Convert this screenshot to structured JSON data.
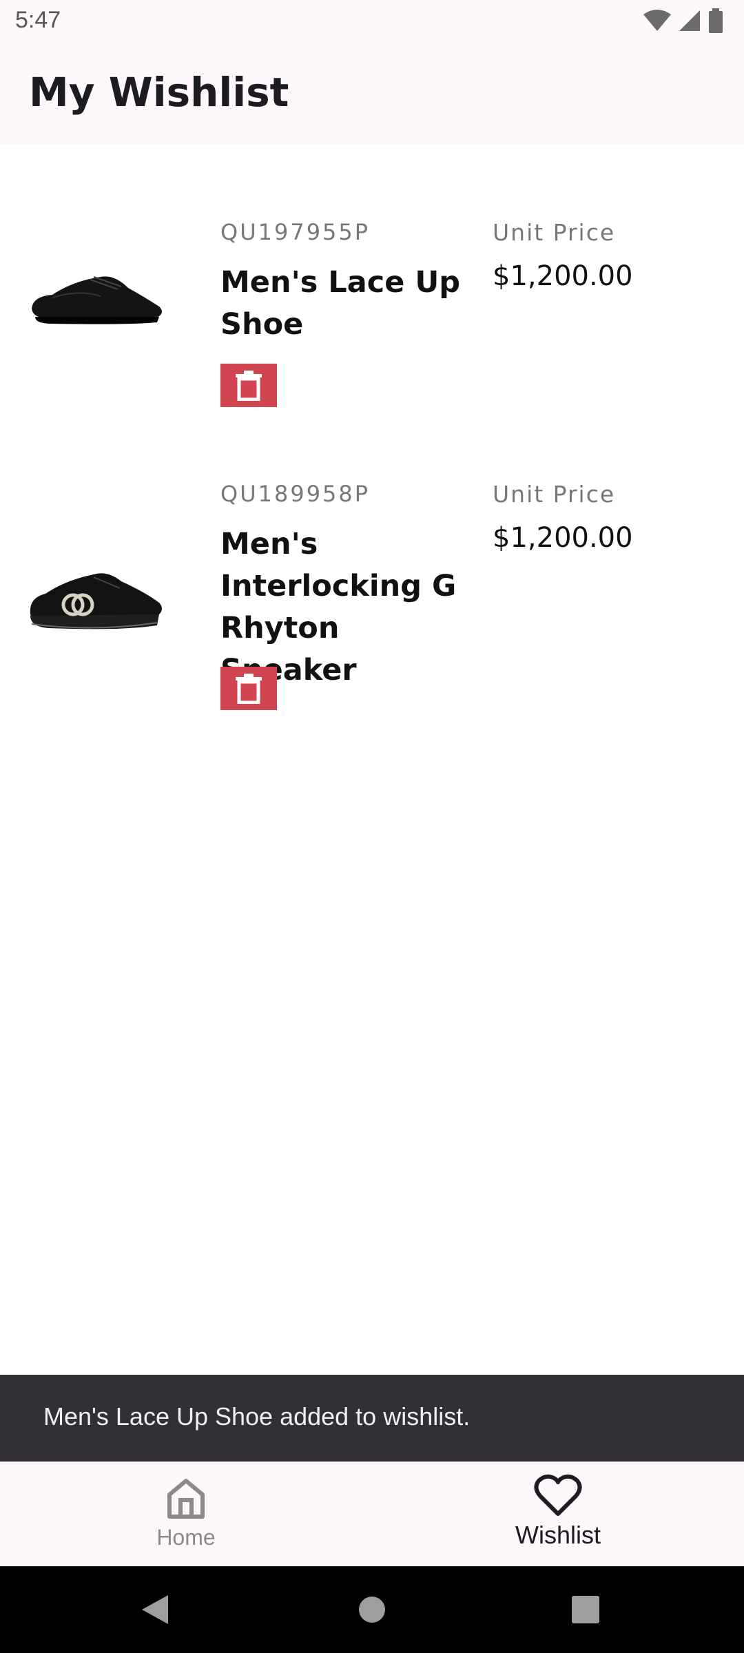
{
  "status_bar": {
    "time": "5:47"
  },
  "app_bar": {
    "title": "My Wishlist"
  },
  "items": [
    {
      "sku": "QU197955P",
      "name": "Men's Lace Up Shoe",
      "unit_label": "Unit Price",
      "price": "$1,200.00",
      "image": "black-oxford-shoe"
    },
    {
      "sku": "QU189958P",
      "name": "Men's Interlocking G Rhyton Sneaker",
      "unit_label": "Unit Price",
      "price": "$1,200.00",
      "image": "black-sneaker"
    }
  ],
  "snackbar": {
    "message": "Men's Lace Up Shoe added to wishlist."
  },
  "bottom_nav": [
    {
      "label": "Home",
      "icon": "home-icon",
      "selected": false
    },
    {
      "label": "Wishlist",
      "icon": "heart-icon",
      "selected": true
    }
  ],
  "colors": {
    "delete": "#d0454f",
    "app_bar_bg": "#fdf6fb",
    "snackbar_bg": "#323036"
  }
}
